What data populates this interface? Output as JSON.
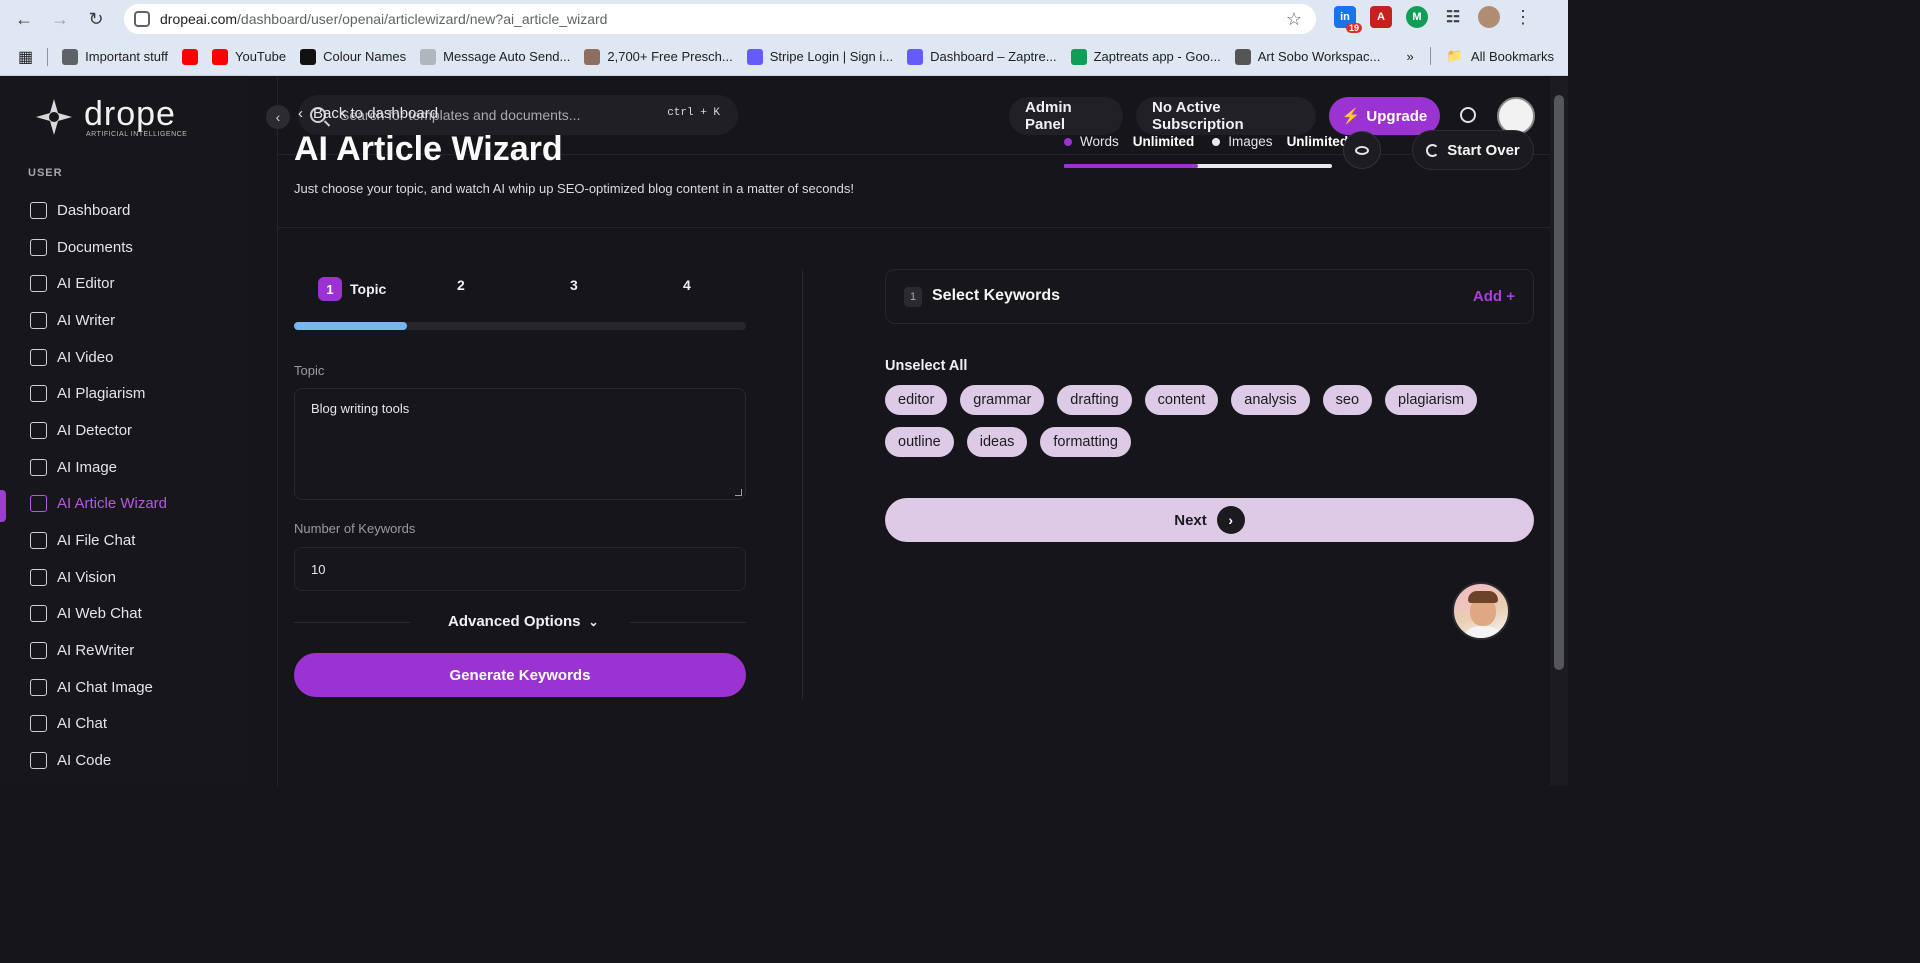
{
  "browser": {
    "url_domain": "dropeai.com",
    "url_path": "/dashboard/user/openai/articlewizard/new?ai_article_wizard",
    "extension_badge": "19",
    "bookmarks": [
      {
        "label": "Important stuff",
        "icon": "folder-icon",
        "color": "#5f6368"
      },
      {
        "label": "",
        "icon": "youtube-icon",
        "color": "#ff0000"
      },
      {
        "label": "YouTube",
        "icon": "youtube-icon",
        "color": "#ff0000"
      },
      {
        "label": "Colour Names",
        "icon": "ds-icon",
        "color": "#111111"
      },
      {
        "label": "Message Auto Send...",
        "icon": "message-icon",
        "color": "#b0b6bd"
      },
      {
        "label": "2,700+ Free Presch...",
        "icon": "image-icon",
        "color": "#8d6e63"
      },
      {
        "label": "Stripe Login | Sign i...",
        "icon": "stripe-icon",
        "color": "#635bff"
      },
      {
        "label": "Dashboard – Zaptre...",
        "icon": "stripe-icon",
        "color": "#635bff"
      },
      {
        "label": "Zaptreats app - Goo...",
        "icon": "sheets-icon",
        "color": "#0f9d58"
      },
      {
        "label": "Art Sobo Workspac...",
        "icon": "mail-icon",
        "color": "#555555"
      }
    ],
    "all_bookmarks": "All Bookmarks",
    "more": "»"
  },
  "sidebar": {
    "logo_word": "drope",
    "logo_sub": "ARTIFICIAL INTELLIGENCE",
    "section_label": "USER",
    "items": [
      {
        "label": "Dashboard",
        "icon": "grid-icon"
      },
      {
        "label": "Documents",
        "icon": "archive-icon"
      },
      {
        "label": "AI Editor",
        "icon": "editor-icon"
      },
      {
        "label": "AI Writer",
        "icon": "document-icon"
      },
      {
        "label": "AI Video",
        "icon": "video-icon"
      },
      {
        "label": "AI Plagiarism",
        "icon": "plagiarism-icon"
      },
      {
        "label": "AI Detector",
        "icon": "scan-icon"
      },
      {
        "label": "AI Image",
        "icon": "image-icon"
      },
      {
        "label": "AI Article Wizard",
        "icon": "wizard-icon",
        "active": true
      },
      {
        "label": "AI File Chat",
        "icon": "file-chat-icon"
      },
      {
        "label": "AI Vision",
        "icon": "vision-icon"
      },
      {
        "label": "AI Web Chat",
        "icon": "globe-icon"
      },
      {
        "label": "AI ReWriter",
        "icon": "pen-icon"
      },
      {
        "label": "AI Chat Image",
        "icon": "image-chat-icon"
      },
      {
        "label": "AI Chat",
        "icon": "chat-icon"
      },
      {
        "label": "AI Code",
        "icon": "code-icon"
      }
    ]
  },
  "topbar": {
    "search_placeholder": "Search for templates and documents...",
    "shortcut": "ctrl + K",
    "admin_panel": "Admin Panel",
    "subscription": "No Active Subscription",
    "upgrade": "Upgrade"
  },
  "header": {
    "back": "Back to dashboard",
    "title": "AI Article Wizard",
    "subtitle": "Just choose your topic, and watch AI whip up SEO-optimized blog content in a matter of seconds!",
    "credits": {
      "words_label": "Words",
      "words_value": "Unlimited",
      "images_label": "Images",
      "images_value": "Unlimited",
      "words_color": "#9b33d2",
      "images_color": "#e8e8ee",
      "words_share": 0.5
    },
    "start_over": "Start Over"
  },
  "wizard": {
    "steps": [
      {
        "num": "1",
        "label": "Topic",
        "active": true
      },
      {
        "num": "2",
        "label": ""
      },
      {
        "num": "3",
        "label": ""
      },
      {
        "num": "4",
        "label": ""
      }
    ],
    "progress": 0.25,
    "topic_label": "Topic",
    "topic_value": "Blog writing tools",
    "keywords_label": "Number of Keywords",
    "keywords_value": "10",
    "advanced": "Advanced Options",
    "generate": "Generate Keywords"
  },
  "keywords_panel": {
    "step_num": "1",
    "title": "Select Keywords",
    "add": "Add +",
    "unselect_all": "Unselect All",
    "chips": [
      "editor",
      "grammar",
      "drafting",
      "content",
      "analysis",
      "seo",
      "plagiarism",
      "outline",
      "ideas",
      "formatting"
    ],
    "next": "Next"
  },
  "colors": {
    "accent": "#9b33d2",
    "chip_bg": "#dccae6",
    "progress": "#79b6f0",
    "background": "#16161a"
  }
}
